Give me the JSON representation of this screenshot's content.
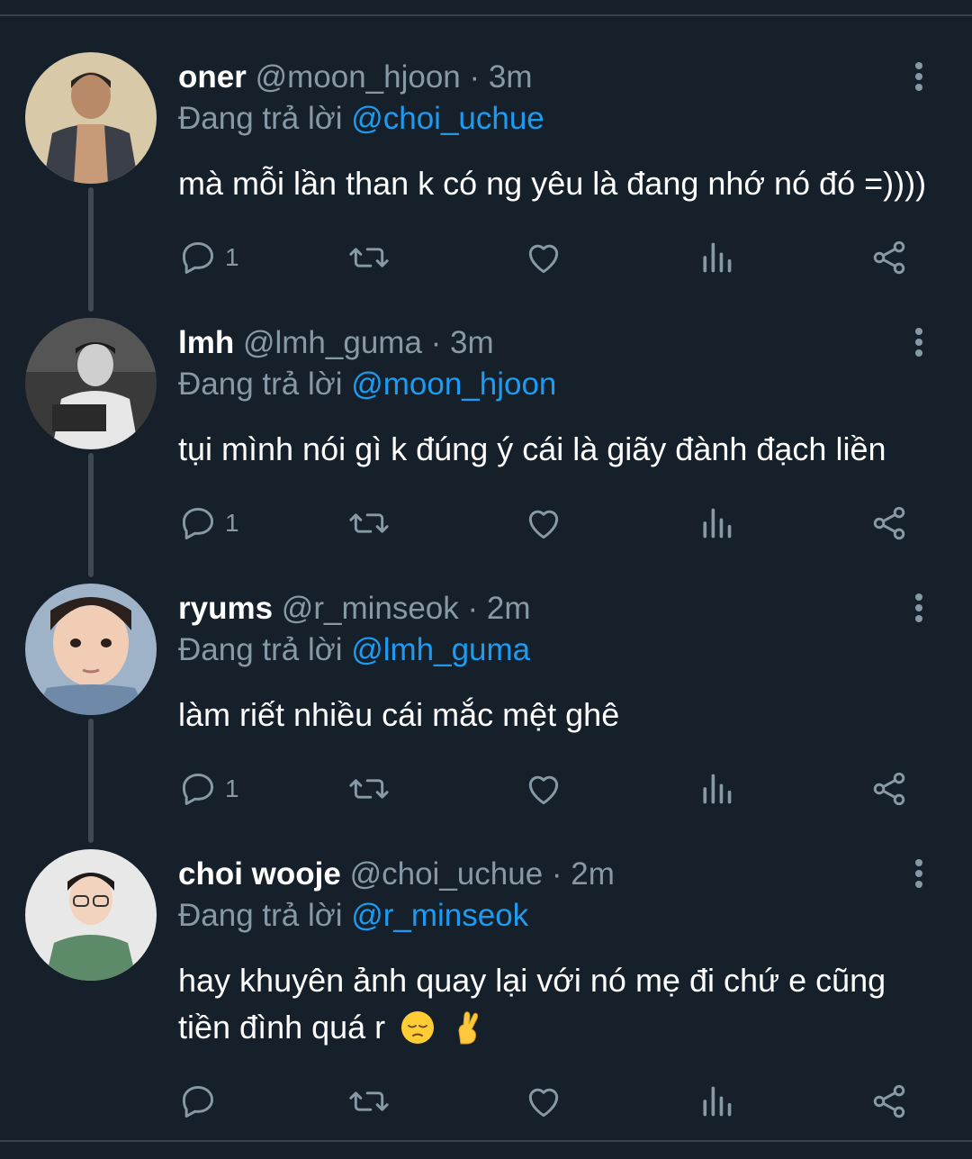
{
  "tweets": [
    {
      "name": "oner",
      "handle": "@moon_hjoon",
      "dot": "·",
      "time": "3m",
      "replying_prefix": "Đang trả lời",
      "replying_to": "@choi_uchue",
      "text": "mà mỗi lần than k có ng yêu là đang nhớ nó đó =))))",
      "reply_count": "1"
    },
    {
      "name": "lmh",
      "handle": "@lmh_guma",
      "dot": "·",
      "time": "3m",
      "replying_prefix": "Đang trả lời",
      "replying_to": "@moon_hjoon",
      "text": "tụi mình nói gì k đúng ý cái là giãy đành đạch liền",
      "reply_count": "1"
    },
    {
      "name": "ryums",
      "handle": "@r_minseok",
      "dot": "·",
      "time": "2m",
      "replying_prefix": "Đang trả lời",
      "replying_to": "@lmh_guma",
      "text": "làm riết nhiều cái mắc mệt ghê",
      "reply_count": "1"
    },
    {
      "name": "choi wooje",
      "handle": "@choi_uchue",
      "dot": "·",
      "time": "2m",
      "replying_prefix": "Đang trả lời",
      "replying_to": "@r_minseok",
      "text_line1": "hay khuyên ảnh quay lại với nó mẹ đi chứ e cũng",
      "text_line2": "tiền đình quá r",
      "emojis": [
        "pensive-face-emoji",
        "crossed-fingers-emoji"
      ],
      "reply_count": ""
    }
  ],
  "icons": {
    "reply": "reply-icon",
    "retweet": "retweet-icon",
    "like": "heart-icon",
    "views": "analytics-icon",
    "share": "share-icon",
    "more": "more-vertical-icon"
  },
  "colors": {
    "background": "#15202b",
    "secondary_text": "#8899a6",
    "link": "#1d9bf0",
    "divider": "#38444d"
  }
}
